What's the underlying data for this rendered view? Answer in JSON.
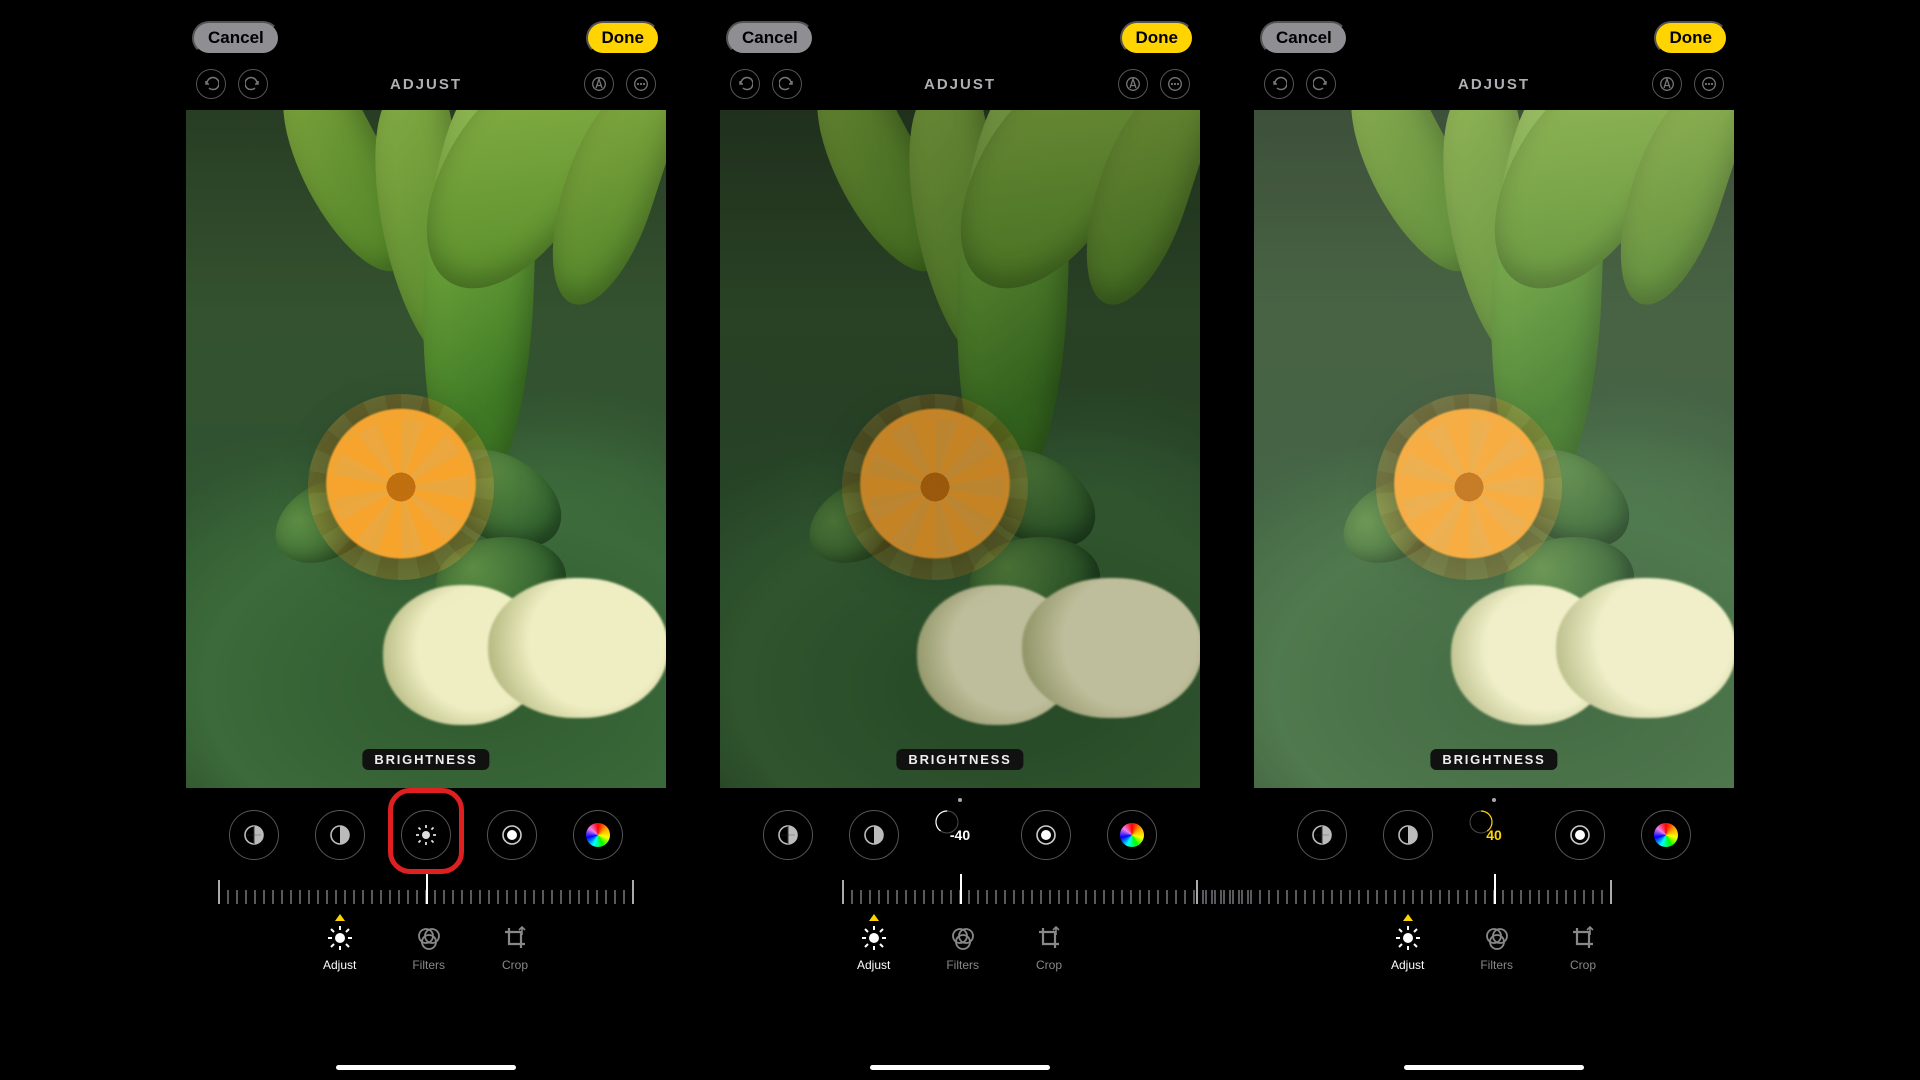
{
  "common": {
    "cancel_label": "Cancel",
    "done_label": "Done",
    "mode_label": "ADJUST",
    "param_badge": "BRIGHTNESS",
    "tabs": {
      "adjust": "Adjust",
      "filters": "Filters",
      "crop": "Crop"
    },
    "dial_names": [
      "exposure",
      "brilliance",
      "brightness",
      "contrast",
      "saturation"
    ]
  },
  "panels": [
    {
      "id": "neutral",
      "brightness_value": 0,
      "value_display": "",
      "value_color": "white",
      "photo_filter": "none",
      "red_callout_on_brightness_icon": true,
      "slider_offset_ticks": 0
    },
    {
      "id": "minus",
      "brightness_value": -40,
      "value_display": "-40",
      "value_color": "white",
      "photo_filter": "dark",
      "red_callout_on_brightness_icon": false,
      "slider_offset_ticks": 10
    },
    {
      "id": "plus",
      "brightness_value": 40,
      "value_display": "40",
      "value_color": "yellow",
      "photo_filter": "bright",
      "red_callout_on_brightness_icon": false,
      "slider_offset_ticks": -10
    }
  ]
}
